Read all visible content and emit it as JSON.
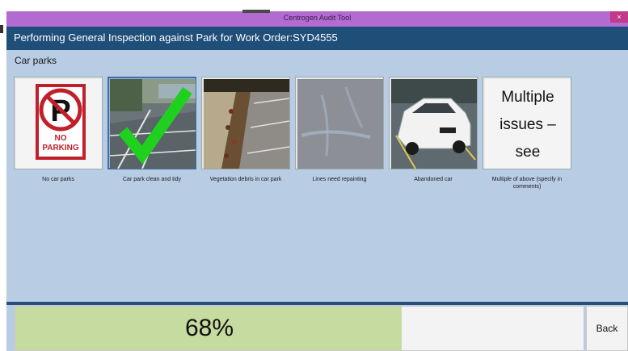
{
  "window": {
    "title": "Centrogen Audit Tool",
    "close_glyph": "×"
  },
  "header": {
    "title": "Performing General Inspection against Park for Work Order:SYD4555"
  },
  "section": {
    "title": "Car parks"
  },
  "options": [
    {
      "caption": "No car parks",
      "image": "no-parking-sign",
      "selected": false
    },
    {
      "caption": "Car park clean and tidy",
      "image": "car-park-with-green-checkmark",
      "selected": true
    },
    {
      "caption": "Vegetation debris in car park",
      "image": "curb-with-leaf-debris",
      "selected": false
    },
    {
      "caption": "Lines need repainting",
      "image": "faded-lines-asphalt",
      "selected": false
    },
    {
      "caption": "Abandoned car",
      "image": "white-sedan-parked",
      "selected": false
    },
    {
      "caption": "Multiple of above (specify in comments)",
      "image": "text-card",
      "tile_text": "Multiple issues – see comments",
      "selected": false
    }
  ],
  "sign_text": "NO PARKING",
  "progress": {
    "percent": 0.68,
    "label": "68%"
  },
  "back_button": {
    "label": "Back"
  }
}
